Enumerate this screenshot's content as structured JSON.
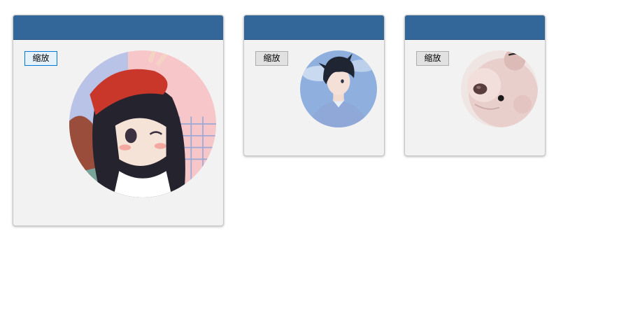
{
  "cards": [
    {
      "button_label": "缩放",
      "avatar": "anime-girl-red-beret-avatar"
    },
    {
      "button_label": "缩放",
      "avatar": "anime-boy-sky-avatar"
    },
    {
      "button_label": "缩放",
      "avatar": "teddy-bear-avatar"
    }
  ],
  "colors": {
    "header": "#336699",
    "card_background": "#f2f2f2",
    "page_background": "#ffffff"
  }
}
